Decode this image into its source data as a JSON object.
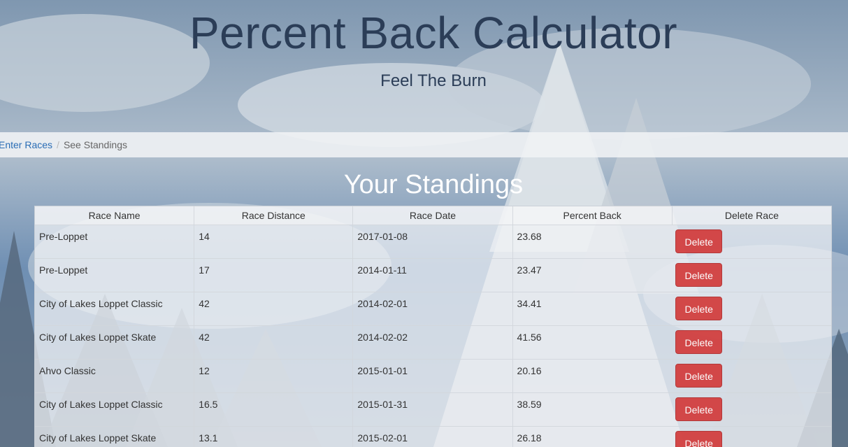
{
  "header": {
    "title": "Percent Back Calculator",
    "subtitle": "Feel The Burn"
  },
  "breadcrumb": {
    "link_label": "Enter Races",
    "separator": "/",
    "current_label": "See Standings"
  },
  "standings": {
    "title": "Your Standings",
    "columns": [
      "Race Name",
      "Race Distance",
      "Race Date",
      "Percent Back",
      "Delete Race"
    ],
    "delete_label": "Delete",
    "rows": [
      {
        "name": "Pre-Loppet",
        "distance": "14",
        "date": "2017-01-08",
        "percent_back": "23.68"
      },
      {
        "name": "Pre-Loppet",
        "distance": "17",
        "date": "2014-01-11",
        "percent_back": "23.47"
      },
      {
        "name": "City of Lakes Loppet Classic",
        "distance": "42",
        "date": "2014-02-01",
        "percent_back": "34.41"
      },
      {
        "name": "City of Lakes Loppet Skate",
        "distance": "42",
        "date": "2014-02-02",
        "percent_back": "41.56"
      },
      {
        "name": "Ahvo Classic",
        "distance": "12",
        "date": "2015-01-01",
        "percent_back": "20.16"
      },
      {
        "name": "City of Lakes Loppet Classic",
        "distance": "16.5",
        "date": "2015-01-31",
        "percent_back": "38.59"
      },
      {
        "name": "City of Lakes Loppet Skate",
        "distance": "13.1",
        "date": "2015-02-01",
        "percent_back": "26.18"
      }
    ]
  },
  "colors": {
    "title_text": "#2b3d57",
    "link": "#2a6db5",
    "delete_button": "#d23b3b"
  }
}
